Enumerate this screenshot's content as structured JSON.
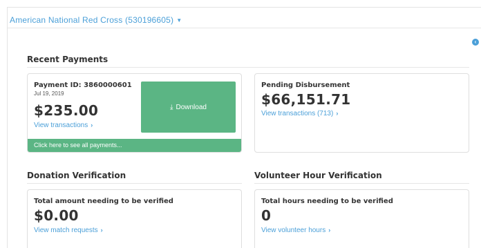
{
  "header": {
    "org_name": "American National Red Cross (530196605)",
    "caret_icon": "caret-down-icon",
    "collapse_icon": "chevron-left-circle-icon"
  },
  "recent_payments": {
    "title": "Recent Payments",
    "payment": {
      "id_label": "Payment ID: 3860000601",
      "date": "Jul 19, 2019",
      "amount": "$235.00",
      "view_link": "View transactions",
      "download_label": "Download",
      "download_icon": "download-icon",
      "see_all": "Click here to see all payments..."
    },
    "pending": {
      "label": "Pending Disbursement",
      "amount": "$66,151.71",
      "view_link": "View transactions (713)"
    }
  },
  "donation_verification": {
    "title": "Donation Verification",
    "label": "Total amount needing to be verified",
    "amount": "$0.00",
    "view_link": "View match requests"
  },
  "volunteer_verification": {
    "title": "Volunteer Hour Verification",
    "label": "Total hours needing to be verified",
    "amount": "0",
    "view_link": "View volunteer hours"
  },
  "colors": {
    "accent_green": "#5bb584",
    "link_blue": "#4a9fd8"
  }
}
